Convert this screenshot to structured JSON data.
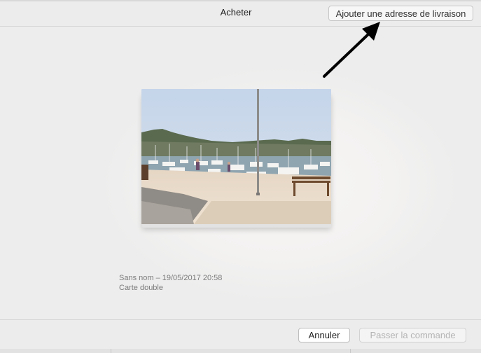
{
  "window": {
    "title": "Acheter",
    "add_address_label": "Ajouter une adresse de livraison"
  },
  "product": {
    "name_date": "Sans nom – 19/05/2017 20:58",
    "format": "Carte double",
    "image_subject": "harbor-photo"
  },
  "footer": {
    "cancel_label": "Annuler",
    "order_label": "Passer la commande",
    "order_enabled": false
  },
  "colors": {
    "background": "#ececec",
    "arrow": "#000000",
    "disabled_text": "#b3b3b3"
  }
}
